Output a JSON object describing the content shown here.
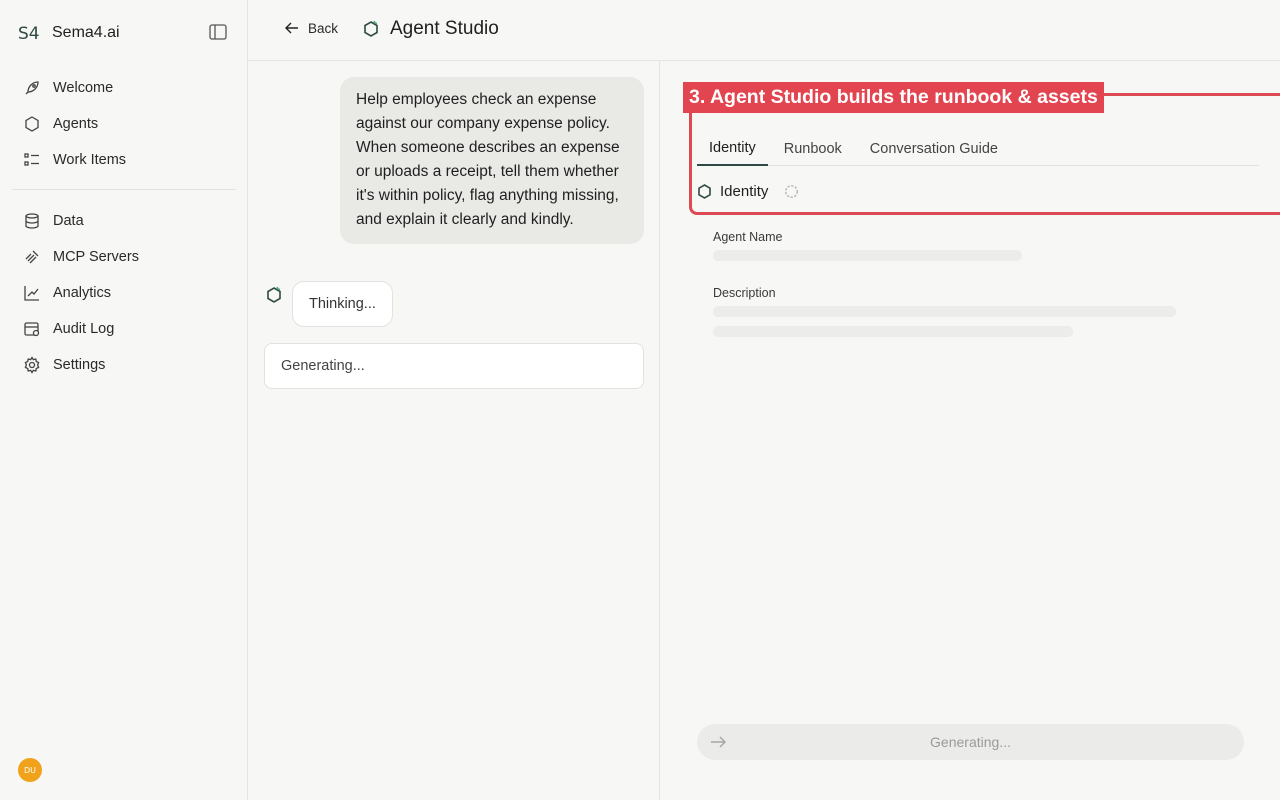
{
  "brand": {
    "name": "Sema4.ai"
  },
  "sidebar": {
    "group1": [
      {
        "label": "Welcome",
        "icon": "rocket-icon"
      },
      {
        "label": "Agents",
        "icon": "hexagon-icon"
      },
      {
        "label": "Work Items",
        "icon": "list-icon"
      }
    ],
    "group2": [
      {
        "label": "Data",
        "icon": "database-icon"
      },
      {
        "label": "MCP Servers",
        "icon": "plug-icon"
      },
      {
        "label": "Analytics",
        "icon": "chart-icon"
      },
      {
        "label": "Audit Log",
        "icon": "audit-icon"
      },
      {
        "label": "Settings",
        "icon": "gear-icon"
      }
    ],
    "avatar_initials": "DU"
  },
  "header": {
    "back_label": "Back",
    "title": "Agent Studio"
  },
  "chat": {
    "user_message": "Help employees check an expense against our company expense policy. When someone describes an expense or uploads a receipt, tell them whether it's within policy, flag anything missing, and explain it clearly and kindly.",
    "thinking_label": "Thinking...",
    "input_text": "Generating..."
  },
  "panel": {
    "tabs": [
      "Identity",
      "Runbook",
      "Conversation Guide"
    ],
    "active_tab": "Identity",
    "section_title": "Identity",
    "agent_name_label": "Agent Name",
    "description_label": "Description",
    "send_label": "Generating..."
  },
  "annotation": {
    "label": "3. Agent Studio builds the runbook & assets",
    "color": "#e2454f"
  }
}
